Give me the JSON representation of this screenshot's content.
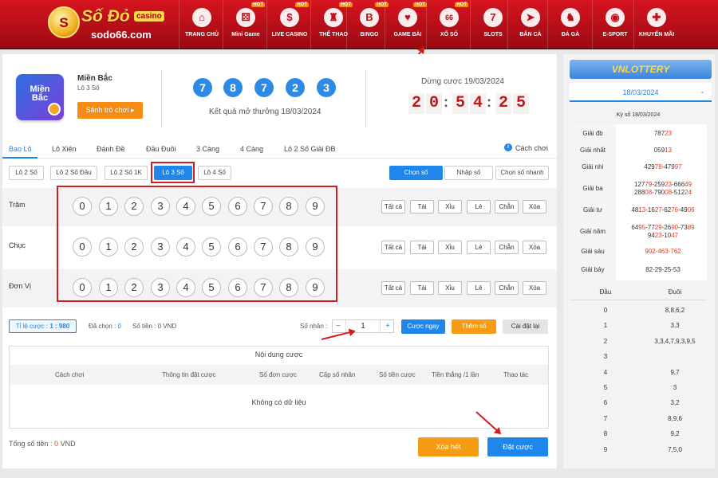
{
  "brand": {
    "logo_text": "Số Đỏ",
    "logo_badge": "casino",
    "domain": "sodo66.com",
    "logo_mark": "S"
  },
  "nav": [
    {
      "label": "TRANG CHỦ",
      "icon": "home-icon",
      "glyph": "⌂",
      "hot": false
    },
    {
      "label": "Mini Game",
      "icon": "dice-icon",
      "glyph": "⚄",
      "hot": true
    },
    {
      "label": "LIVE CASINO",
      "icon": "dollar-icon",
      "glyph": "$",
      "hot": true
    },
    {
      "label": "THỂ THAO",
      "icon": "trophy-icon",
      "glyph": "♜",
      "hot": true
    },
    {
      "label": "BINGO",
      "icon": "bingo-icon",
      "glyph": "B",
      "hot": true
    },
    {
      "label": "GAME BÀI",
      "icon": "cards-icon",
      "glyph": "♥",
      "hot": true
    },
    {
      "label": "XỔ SỐ",
      "icon": "lottery-ball-icon",
      "glyph": "66",
      "hot": true
    },
    {
      "label": "SLOTS",
      "icon": "slot-machine-icon",
      "glyph": "7",
      "hot": false
    },
    {
      "label": "BẮN CÁ",
      "icon": "fish-icon",
      "glyph": "➤",
      "hot": false
    },
    {
      "label": "ĐÁ GÀ",
      "icon": "rooster-icon",
      "glyph": "♞",
      "hot": false
    },
    {
      "label": "E-SPORT",
      "icon": "gamepad-icon",
      "glyph": "◉",
      "hot": false
    },
    {
      "label": "KHUYẾN MÃI",
      "icon": "gift-icon",
      "glyph": "✚",
      "hot": false
    }
  ],
  "game": {
    "badge_text": "Miền Bắc",
    "region": "Miền Bắc",
    "type": "Lô 3 Số",
    "lobby_button": "Sảnh trò chơi ▸",
    "result_numbers": [
      "7",
      "8",
      "7",
      "2",
      "3"
    ],
    "result_caption": "Kết quả mở thưởng 18/03/2024",
    "stop_label": "Dừng cược 19/03/2024",
    "countdown": [
      "2",
      "0",
      "5",
      "4",
      "2",
      "5"
    ],
    "countdown_seps": [
      ":",
      ":"
    ]
  },
  "tabs": [
    "Bao Lô",
    "Lô Xiên",
    "Đánh Đề",
    "Đầu Đuôi",
    "3 Càng",
    "4 Càng",
    "Lô 2 Số Giải ĐB"
  ],
  "how_to_play": "Cách chơi",
  "subtabs": [
    "Lô 2 Số",
    "Lô 2 Số Đầu",
    "Lô 2 Số 1K",
    "Lô 3 Số",
    "Lô 4 Số"
  ],
  "modes": [
    "Chọn số",
    "Nhập số",
    "Chọn số nhanh"
  ],
  "rows": [
    {
      "label": "Trăm"
    },
    {
      "label": "Chục"
    },
    {
      "label": "Đơn Vị"
    }
  ],
  "digits": [
    "0",
    "1",
    "2",
    "3",
    "4",
    "5",
    "6",
    "7",
    "8",
    "9"
  ],
  "quick": [
    "Tất cả",
    "Tài",
    "Xỉu",
    "Lẻ",
    "Chẵn",
    "Xóa"
  ],
  "bet": {
    "odds_label": "Tỉ lệ cược : ",
    "odds_value": "1 : 980",
    "chosen_label": "Đã chọn : ",
    "chosen_value": "0",
    "money_label": "Số tiền : ",
    "money_value": "0 VND",
    "multiplier_label": "Số nhân :",
    "minus": "−",
    "multiplier_value": "1",
    "plus": "+",
    "bet_now": "Cược ngay",
    "add_number": "Thêm số",
    "reset": "Cài đặt lại"
  },
  "table": {
    "title": "Nội dung cược",
    "headers": [
      "Cách chơi",
      "Thông tin đặt cược",
      "Số đơn cược",
      "Cấp số nhân",
      "Số tiền cược",
      "Tiền thắng /1 lần",
      "Thao tác"
    ],
    "empty": "Không có dữ liệu"
  },
  "footer": {
    "total_label": "Tổng số tiền : ",
    "total_value": "0",
    "total_unit": " VND",
    "clear": "Xóa hết",
    "place_bet": "Đặt cược"
  },
  "sidebar": {
    "vnlottery": "VNLOTTERY",
    "date": "18/03/2024",
    "ky_so": "Kỳ số 18/03/2024",
    "prizes": [
      {
        "name": "Giải đb",
        "value": [
          [
            "787",
            ""
          ],
          [
            "23",
            "r"
          ]
        ]
      },
      {
        "name": "Giải nhất",
        "value": [
          [
            "059",
            ""
          ],
          [
            "13",
            "r"
          ]
        ]
      },
      {
        "name": "Giải nhì",
        "value": [
          [
            "429",
            ""
          ],
          [
            "78",
            "r"
          ],
          [
            "-479",
            ""
          ],
          [
            "97",
            "r"
          ]
        ]
      },
      {
        "name": "Giải ba",
        "value": [
          [
            "127",
            ""
          ],
          [
            "79",
            "r"
          ],
          [
            "-259",
            ""
          ],
          [
            "23",
            "r"
          ],
          [
            "-666",
            ""
          ],
          [
            "49",
            "r"
          ],
          [
            "\n288",
            ""
          ],
          [
            "08",
            "r"
          ],
          [
            "-790",
            ""
          ],
          [
            "08",
            "r"
          ],
          [
            "-512",
            ""
          ],
          [
            "24",
            "r"
          ]
        ]
      },
      {
        "name": "Giải tư",
        "value": [
          [
            "48",
            ""
          ],
          [
            "13",
            "r"
          ],
          [
            "-16",
            ""
          ],
          [
            "27",
            "r"
          ],
          [
            "-62",
            ""
          ],
          [
            "76",
            "r"
          ],
          [
            "-49",
            ""
          ],
          [
            "06",
            "r"
          ]
        ]
      },
      {
        "name": "Giải năm",
        "value": [
          [
            "64",
            ""
          ],
          [
            "95",
            "r"
          ],
          [
            "-77",
            ""
          ],
          [
            "29",
            "r"
          ],
          [
            "-26",
            ""
          ],
          [
            "90",
            "r"
          ],
          [
            "-73",
            ""
          ],
          [
            "89",
            "r"
          ],
          [
            "\n94",
            ""
          ],
          [
            "23",
            "r"
          ],
          [
            "-10",
            ""
          ],
          [
            "47",
            "r"
          ]
        ]
      },
      {
        "name": "Giải sáu",
        "value": [
          [
            "902-463-762",
            "r"
          ]
        ]
      },
      {
        "name": "Giải bảy",
        "value": [
          [
            "82-29-25-53",
            ""
          ]
        ]
      }
    ],
    "head_label": "Đầu",
    "tail_label": "Đuôi",
    "dau_duoi": [
      {
        "d": "0",
        "t": "8,8,6,2"
      },
      {
        "d": "1",
        "t": "3,3"
      },
      {
        "d": "2",
        "t": "3,3,4,7,9,3,9,5"
      },
      {
        "d": "3",
        "t": ""
      },
      {
        "d": "4",
        "t": "9,7"
      },
      {
        "d": "5",
        "t": "3"
      },
      {
        "d": "6",
        "t": "3,2"
      },
      {
        "d": "7",
        "t": "8,9,6"
      },
      {
        "d": "8",
        "t": "9,2"
      },
      {
        "d": "9",
        "t": "7,5,0"
      }
    ]
  },
  "colors": {
    "brand_red": "#c10d17",
    "accent_blue": "#1f86ec",
    "orange": "#f59b14",
    "highlight": "#e23b22"
  }
}
